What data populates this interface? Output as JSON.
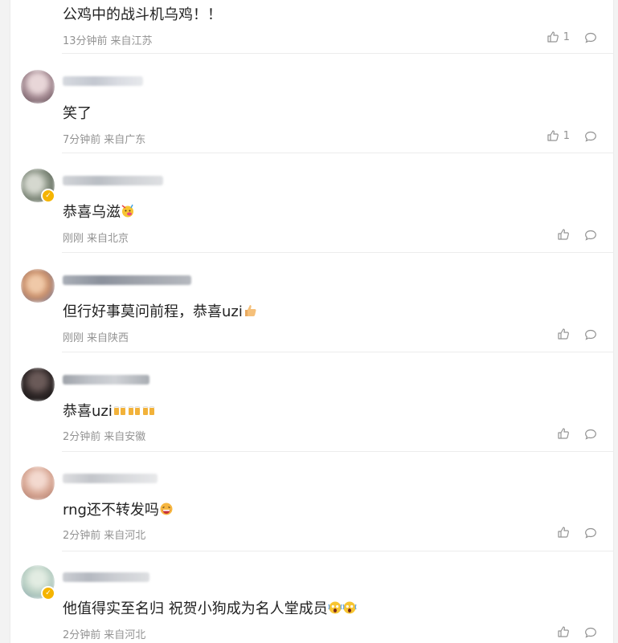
{
  "comments": [
    {
      "text": "公鸡中的战斗机乌鸡！！",
      "time": "13分钟前",
      "location": "来自江苏",
      "likes": "1",
      "verified": false
    },
    {
      "text": "笑了",
      "time": "7分钟前",
      "location": "来自广东",
      "likes": "1",
      "verified": false
    },
    {
      "text": "恭喜乌滋",
      "time": "刚刚",
      "location": "来自北京",
      "likes": "",
      "verified": true,
      "emoji": [
        "party-face-emoji"
      ]
    },
    {
      "text": "但行好事莫问前程，恭喜uzi",
      "time": "刚刚",
      "location": "来自陕西",
      "likes": "",
      "verified": false,
      "emoji": [
        "thumbs-up-emoji"
      ]
    },
    {
      "text": "恭喜uzi",
      "time": "2分钟前",
      "location": "来自安徽",
      "likes": "",
      "verified": false,
      "emoji": [
        "cheers-emoji",
        "cheers-emoji",
        "cheers-emoji"
      ]
    },
    {
      "text": "rng还不转发吗",
      "time": "2分钟前",
      "location": "来自河北",
      "likes": "",
      "verified": false,
      "emoji": [
        "laughing-face-emoji"
      ]
    },
    {
      "text": "他值得实至名归 祝贺小狗成为名人堂成员",
      "time": "2分钟前",
      "location": "来自河北",
      "likes": "",
      "verified": true,
      "emoji": [
        "screaming-face-emoji",
        "screaming-face-emoji"
      ]
    }
  ],
  "colors": {
    "text": "#222222",
    "meta": "#939393",
    "divider": "#ececec"
  }
}
